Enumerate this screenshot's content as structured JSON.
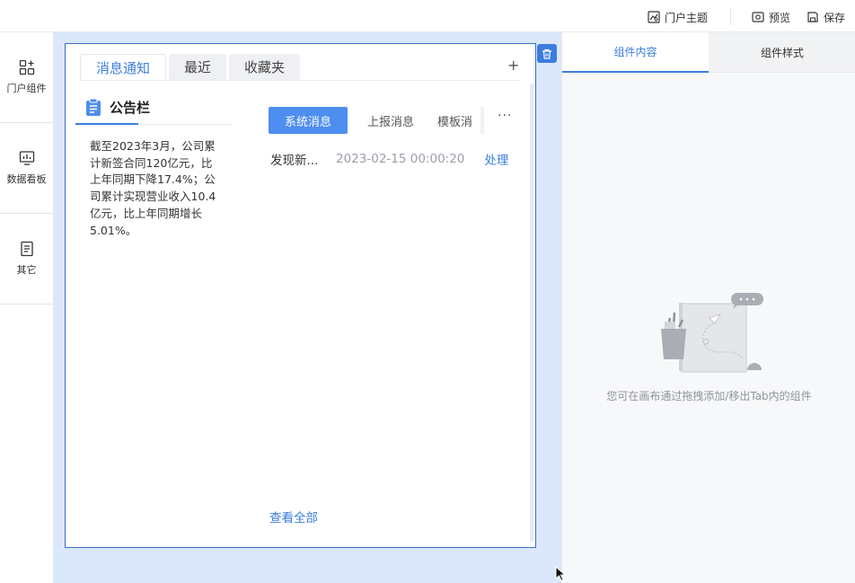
{
  "toolbar": {
    "theme_label": "门户主题",
    "preview_label": "预览",
    "save_label": "保存"
  },
  "sidebar": {
    "items": [
      {
        "label": "门户组件",
        "icon": "grid-plus-icon"
      },
      {
        "label": "数据看板",
        "icon": "dashboard-icon"
      },
      {
        "label": "其它",
        "icon": "document-icon"
      }
    ]
  },
  "widget": {
    "tabs": [
      "消息通知",
      "最近",
      "收藏夹"
    ],
    "active_tab": "消息通知",
    "add_symbol": "+"
  },
  "bulletin": {
    "title": "公告栏",
    "text": "截至2023年3月，公司累计新签合同120亿元，比上年同期下降17.4%；公司累计实现营业收入10.4亿元，比上年同期增长5.01%。"
  },
  "messages": {
    "tabs": [
      "系统消息",
      "上报消息",
      "模板消"
    ],
    "active_tab": "系统消息",
    "more_symbol": "···",
    "rows": [
      {
        "title": "发现新...",
        "time": "2023-02-15 00:00:20",
        "action": "处理"
      }
    ],
    "view_all": "查看全部"
  },
  "right_panel": {
    "tabs": [
      "组件内容",
      "组件样式"
    ],
    "active_tab": "组件内容",
    "empty_text": "您可在画布通过拖拽添加/移出Tab内的组件"
  },
  "colors": {
    "accent": "#3b7de0",
    "canvas_bg": "#dbe8fb",
    "panel_bg": "#f7f8fa"
  }
}
